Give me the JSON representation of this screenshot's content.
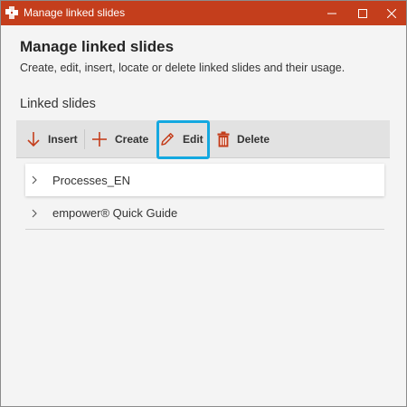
{
  "window": {
    "title": "Manage linked slides",
    "accent_color": "#c43e1c",
    "controls": {
      "minimize": "minimize-icon",
      "maximize": "maximize-icon",
      "close": "close-icon"
    }
  },
  "dialog": {
    "heading": "Manage linked slides",
    "description": "Create, edit, insert, locate or delete linked slides and their usage.",
    "section_label": "Linked slides"
  },
  "toolbar": {
    "buttons": [
      {
        "label": "Insert",
        "icon": "arrow-down-icon",
        "color": "#c43e1c"
      },
      {
        "label": "Create",
        "icon": "plus-icon",
        "color": "#c43e1c"
      },
      {
        "label": "Edit",
        "icon": "pencil-icon",
        "color": "#c43e1c",
        "highlighted": true
      },
      {
        "label": "Delete",
        "icon": "trash-icon",
        "color": "#c43e1c"
      }
    ],
    "highlight_color": "#14a8e0"
  },
  "linked_slides": [
    {
      "label": "Processes_EN",
      "expanded": false
    },
    {
      "label": "empower® Quick Guide",
      "expanded": false
    }
  ]
}
